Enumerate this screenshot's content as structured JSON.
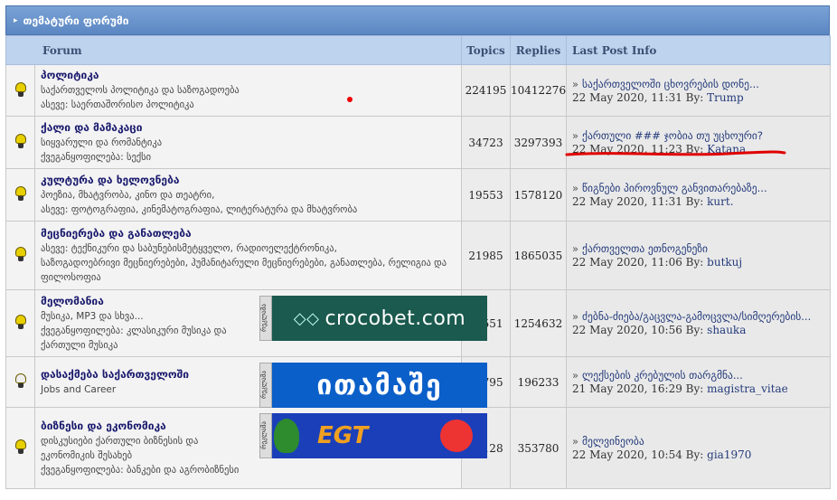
{
  "category": {
    "title": "თემატური ფორუმი"
  },
  "columns": {
    "forum": "Forum",
    "topics": "Topics",
    "replies": "Replies",
    "last_post": "Last Post Info"
  },
  "forums": [
    {
      "title": "პოლიტიკა",
      "desc": "საქართველოს პოლიტიკა და საზოგადოება",
      "sub": "ასევე: საერთაშორისო პოლიტიკა",
      "topics": "224195",
      "replies": "10412276",
      "last_topic": "საქართველოში ცხოვრების დონე...",
      "last_date": "22 May 2020, 11:31 By:",
      "last_by": "Trump",
      "icon": "bulb-on-icon"
    },
    {
      "title": "ქალი და მამაკაცი",
      "desc": "სიყვარული და რომანტიკა",
      "sub": "ქვეგანყოფილება: სექსი",
      "topics": "34723",
      "replies": "3297393",
      "last_topic": "ქართული ### ჯობია თუ უცხოური?",
      "last_date": "22 May 2020, 11:23 By:",
      "last_by": "Katana",
      "icon": "bulb-on-icon"
    },
    {
      "title": "კულტურა და ხელოვნება",
      "desc": "პოეზია, მხატვრობა, კინო და თეატრი,",
      "sub": "ასევე: ფოტოგრაფია, კინემატოგრაფია, ლიტერატურა და მხატვრობა",
      "topics": "19553",
      "replies": "1578120",
      "last_topic": "წიგნები პიროვნულ განვითარებაზე...",
      "last_date": "22 May 2020, 11:31 By:",
      "last_by": "kurt.",
      "icon": "bulb-on-icon"
    },
    {
      "title": "მეცნიერება და განათლება",
      "desc": "ასევე: ტექნიკური და საბუნებისმეტყველო, რადიოელექტრონიკა,",
      "sub": "საზოგადოებრივი მეცნიერებები, ჰუმანიტარული მეცნიერებები, განათლება, რელიგია და ფილოსოფია",
      "topics": "21985",
      "replies": "1865035",
      "last_topic": "ქართველთა ეთნოგენეზი",
      "last_date": "22 May 2020, 11:06 By:",
      "last_by": "butkuj",
      "icon": "bulb-on-icon"
    },
    {
      "title": "მელომანია",
      "desc": "მუსიკა, MP3 და სხვა...",
      "sub": "ქვეგანყოფილება: კლასიკური მუსიკა და ქართული მუსიკა",
      "topics": "20551",
      "replies": "1254632",
      "last_topic": "ძებნა-ძიება/გაცვლა-გამოცვლა/სიმღერების...",
      "last_date": "22 May 2020, 10:56 By:",
      "last_by": "shauka",
      "icon": "bulb-on-icon",
      "banner": {
        "kind": "croco",
        "text": "crocobet.com",
        "side": "რეკლამა"
      }
    },
    {
      "title": "დასაქმება საქართველოში",
      "desc": "Jobs and Career",
      "sub": "",
      "topics": "15795",
      "replies": "196233",
      "last_topic": "ლექსების კრებულის თარგმნა...",
      "last_date": "21 May 2020, 16:29 By:",
      "last_by": "magistra_vitae",
      "icon": "bulb-off-icon",
      "banner": {
        "kind": "itamashe",
        "text": "ითამაშე",
        "side": "რეკლამა"
      }
    },
    {
      "title": "ბიზნესი და ეკონომიკა",
      "desc": "დისკუსიები ქართული ბიზნესის და ეკონომიკის შესახებ",
      "sub": "ქვეგანყოფილება: ბანკები და აგრობიზნესი",
      "topics": "15128",
      "replies": "353780",
      "last_topic": "მელვინეობა",
      "last_date": "22 May 2020, 10:54 By:",
      "last_by": "gia1970",
      "icon": "bulb-on-icon",
      "banner": {
        "kind": "egt",
        "text": "EGT",
        "side": "რეკლამა"
      }
    }
  ]
}
